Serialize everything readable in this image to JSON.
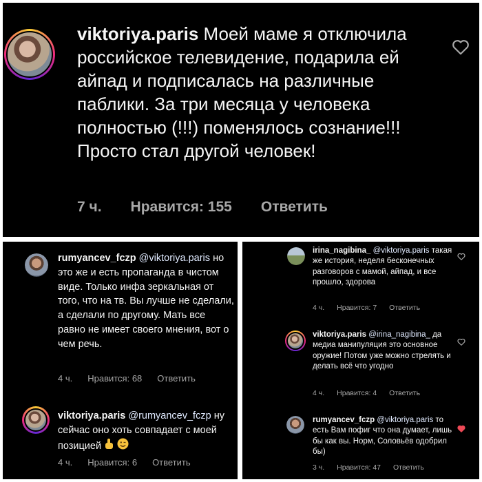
{
  "main": {
    "username": "viktoriya.paris",
    "text": "Моей маме я отключила российское телевидение, подарила ей айпад и подписалась на различные паблики. За три месяца у человека полностью (!!!) поменялось сознание!!! Просто стал другой человек!",
    "time": "7 ч.",
    "likes": "Нравится: 155",
    "reply": "Ответить"
  },
  "left_comments": [
    {
      "username": "rumyancev_fczp",
      "mention": "@viktoriya.paris",
      "text": "но это же и есть пропаганда в чистом виде. Только инфа зеркальная от того, что на тв. Вы лучше не сделали, а сделали по другому. Мать все равно не имеет своего мнения, вот о чем речь.",
      "time": "4 ч.",
      "likes": "Нравится: 68",
      "reply": "Ответить"
    },
    {
      "username": "viktoriya.paris",
      "mention": "@rumyancev_fczp",
      "text": "ну сейчас оно хоть совпадает с моей позицией",
      "emojis": [
        "point-up-emoji",
        "wink-emoji"
      ],
      "time": "4 ч.",
      "likes": "Нравится: 6",
      "reply": "Ответить"
    }
  ],
  "right_comments": [
    {
      "username": "irina_nagibina_",
      "mention": "@viktoriya.paris",
      "text": "такая же история, неделя бесконечных разговоров с мамой, айпад, и все прошло, здорова",
      "time": "4 ч.",
      "likes": "Нравится: 7",
      "reply": "Ответить"
    },
    {
      "username": "viktoriya.paris",
      "mention": "@irina_nagibina_",
      "text": "да медиа манипуляция это основное оружие! Потом уже можно стрелять и делать всё что угодно",
      "time": "4 ч.",
      "likes": "Нравится: 4",
      "reply": "Ответить"
    },
    {
      "username": "rumyancev_fczp",
      "mention": "@viktoriya.paris",
      "text": "то есть Вам пофиг что она думает, лишь бы как вы. Норм, Соловьёв одобрил бы)",
      "time": "3 ч.",
      "likes": "Нравится: 47",
      "reply": "Ответить",
      "liked": true
    }
  ],
  "colors": {
    "background": "#000000",
    "text": "#f5f5f5",
    "meta": "#a8a8a8",
    "liked_heart": "#ed4956"
  }
}
